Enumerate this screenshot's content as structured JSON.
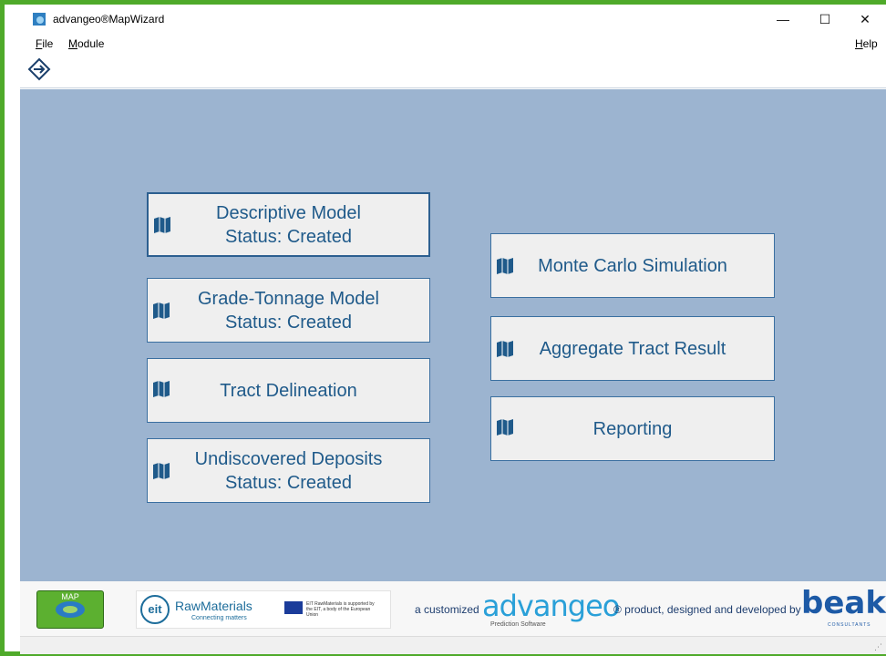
{
  "window": {
    "title": "advangeo®MapWizard",
    "minimize": "—",
    "maximize": "☐",
    "close": "✕"
  },
  "menu": {
    "file_key": "F",
    "file_rest": "ile",
    "module_key": "M",
    "module_rest": "odule",
    "help_key": "H",
    "help_rest": "elp"
  },
  "tiles_left": [
    {
      "line1": "Descriptive Model",
      "line2": "Status: Created"
    },
    {
      "line1": "Grade-Tonnage Model",
      "line2": "Status: Created"
    },
    {
      "line1": "Tract Delineation",
      "line2": ""
    },
    {
      "line1": "Undiscovered Deposits",
      "line2": "Status: Created"
    }
  ],
  "tiles_right": [
    {
      "line1": "Monte Carlo Simulation"
    },
    {
      "line1": "Aggregate Tract Result"
    },
    {
      "line1": "Reporting"
    }
  ],
  "footer": {
    "map_logo_text": "MAP",
    "eit": "eit",
    "raw_materials": "RawMaterials",
    "raw_materials_sub": "Connecting matters",
    "eu_text": "EIT RawMaterials is supported by the EIT, a body of the European Union",
    "tagline_pre": "a customized",
    "advangeo": "advangeo",
    "prediction_software": "Prediction Software",
    "tagline_post": "® product, designed and developed by",
    "beak": "beak",
    "beak_sub": "CONSULTANTS"
  },
  "colors": {
    "frame": "#4faa2a",
    "content_bg": "#9cb4d0",
    "tile_text": "#1f5a8a",
    "tile_border": "#3a6fa0"
  }
}
